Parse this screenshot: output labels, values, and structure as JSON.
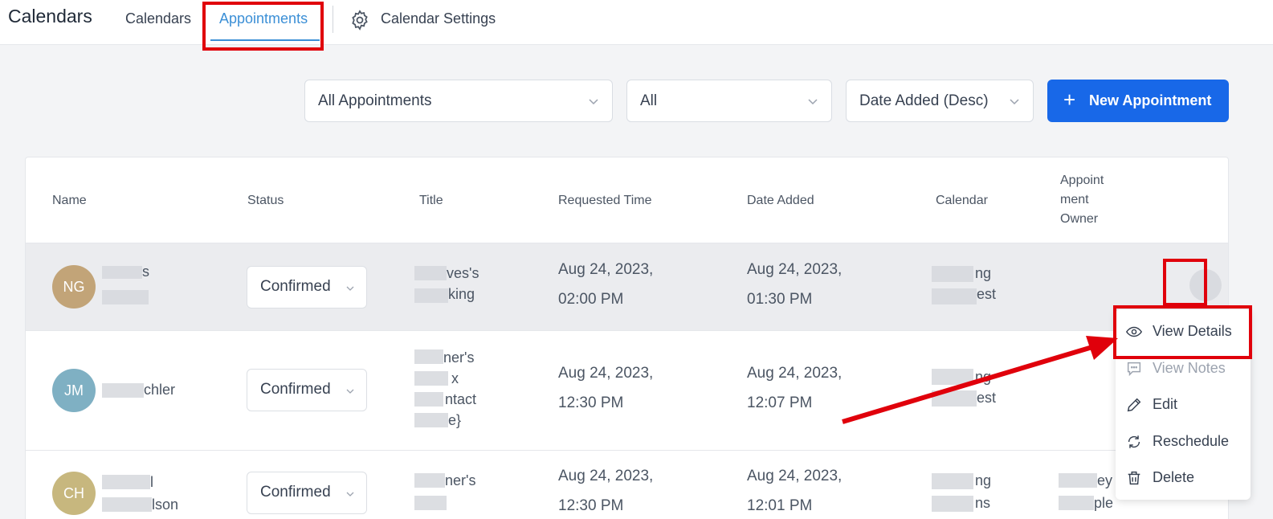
{
  "header": {
    "app_title": "Calendars",
    "tabs": [
      {
        "label": "Calendars"
      },
      {
        "label": "Appointments"
      },
      {
        "label": "Calendar Settings"
      }
    ],
    "settings_icon": "gear-icon",
    "active_color": "#3b8fd6"
  },
  "filters": {
    "appointments_filter": "All Appointments",
    "status_filter": "All",
    "sort": "Date Added (Desc)",
    "new_button": "New Appointment",
    "new_button_color": "#1868e8"
  },
  "table": {
    "columns": {
      "name": "Name",
      "status": "Status",
      "title": "Title",
      "requested_time": "Requested Time",
      "date_added": "Date Added",
      "calendar": "Calendar",
      "owner_line1": "Appoint",
      "owner_line2": "ment",
      "owner_line3": "Owner"
    },
    "rows": [
      {
        "initials": "NG",
        "avatar_color": "#c2a478",
        "name_l1": "s",
        "name_l2": "",
        "status": "Confirmed",
        "title_l1": "ves's",
        "title_l2": "king",
        "requested_l1": "Aug 24, 2023,",
        "requested_l2": "02:00 PM",
        "added_l1": "Aug 24, 2023,",
        "added_l2": "01:30 PM",
        "calendar_l1": "ng",
        "calendar_l2": "est",
        "owner_l1": "",
        "owner_l2": ""
      },
      {
        "initials": "JM",
        "avatar_color": "#7fb0c3",
        "name_l1": "chler",
        "status": "Confirmed",
        "title_l1": "ner's",
        "title_l2": "x",
        "title_l3": "ntact",
        "title_l4": "e}",
        "requested_l1": "Aug 24, 2023,",
        "requested_l2": "12:30 PM",
        "added_l1": "Aug 24, 2023,",
        "added_l2": "12:07 PM",
        "calendar_l1": "ng",
        "calendar_l2": "est"
      },
      {
        "initials": "CH",
        "avatar_color": "#c7b77e",
        "name_l1": "l",
        "name_l2": "lson",
        "status": "Confirmed",
        "title_l1": "ner's",
        "requested_l1": "Aug 24, 2023,",
        "requested_l2": "12:30 PM",
        "added_l1": "Aug 24, 2023,",
        "added_l2": "12:01 PM",
        "calendar_l1": "ng",
        "calendar_l2": "ns",
        "owner_l1": "ey",
        "owner_l2": "ple"
      }
    ]
  },
  "row_menu": {
    "items": [
      {
        "label": "View Details",
        "icon": "eye-icon"
      },
      {
        "label": "View Notes",
        "icon": "notes-icon"
      },
      {
        "label": "Edit",
        "icon": "pencil-icon"
      },
      {
        "label": "Reschedule",
        "icon": "refresh-icon"
      },
      {
        "label": "Delete",
        "icon": "trash-icon"
      }
    ]
  },
  "annotation_color": "#e0000b"
}
